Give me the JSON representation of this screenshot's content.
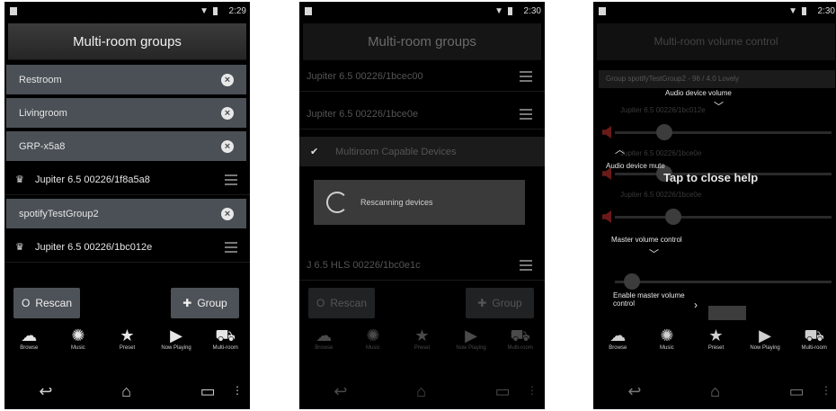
{
  "panel1": {
    "status_time": "2:29",
    "title": "Multi-room groups",
    "rows": [
      {
        "kind": "group",
        "label": "Restroom"
      },
      {
        "kind": "group",
        "label": "Livingroom"
      },
      {
        "kind": "group",
        "label": "GRP-x5a8"
      },
      {
        "kind": "device",
        "label": "Jupiter 6.5 00226/1f8a5a8"
      },
      {
        "kind": "group",
        "label": "spotifyTestGroup2"
      },
      {
        "kind": "device",
        "label": "Jupiter 6.5 00226/1bc012e"
      }
    ],
    "rescan_label": "Rescan",
    "group_label": "Group"
  },
  "panel2": {
    "status_time": "2:30",
    "title": "Multi-room groups",
    "rows": [
      {
        "label": "Jupiter 6.5 00226/1bcec00"
      },
      {
        "label": "Jupiter 6.5 00226/1bce0e"
      },
      {
        "label": "Multiroom Capable Devices"
      },
      {
        "label": "J 6.5 HLS 00226/1bc0e1c"
      }
    ],
    "dialog_text": "Rescanning devices",
    "rescan_label": "Rescan",
    "group_label": "Group"
  },
  "panel3": {
    "status_time": "2:30",
    "title": "Multi-room volume control",
    "subheader": "Group spotifyTestGroup2 - 96 / 4.0 Lovely",
    "dim_rows": [
      "Jupiter 6.5 00226/1bc012e",
      "Jupiter 6.5 00226/1bce0e",
      "Jupiter 6.5 00226/1bce0e"
    ],
    "help_audio_volume": "Audio device volume",
    "help_audio_mute": "Audio device mute",
    "help_tap_close": "Tap to close help",
    "help_master": "Master volume control",
    "help_enable_master": "Enable master volume control"
  },
  "tabs": [
    {
      "icon": "browse-icon",
      "label": "Browse"
    },
    {
      "icon": "music-icon",
      "label": "Music"
    },
    {
      "icon": "star-icon",
      "label": "Preset"
    },
    {
      "icon": "play-icon",
      "label": "Now Playing"
    },
    {
      "icon": "sofa-icon",
      "label": "Multi-room"
    }
  ],
  "colors": {
    "row_bg": "#4a5056",
    "button_bg": "#4d5258",
    "mute_red": "#6b1a1a"
  }
}
